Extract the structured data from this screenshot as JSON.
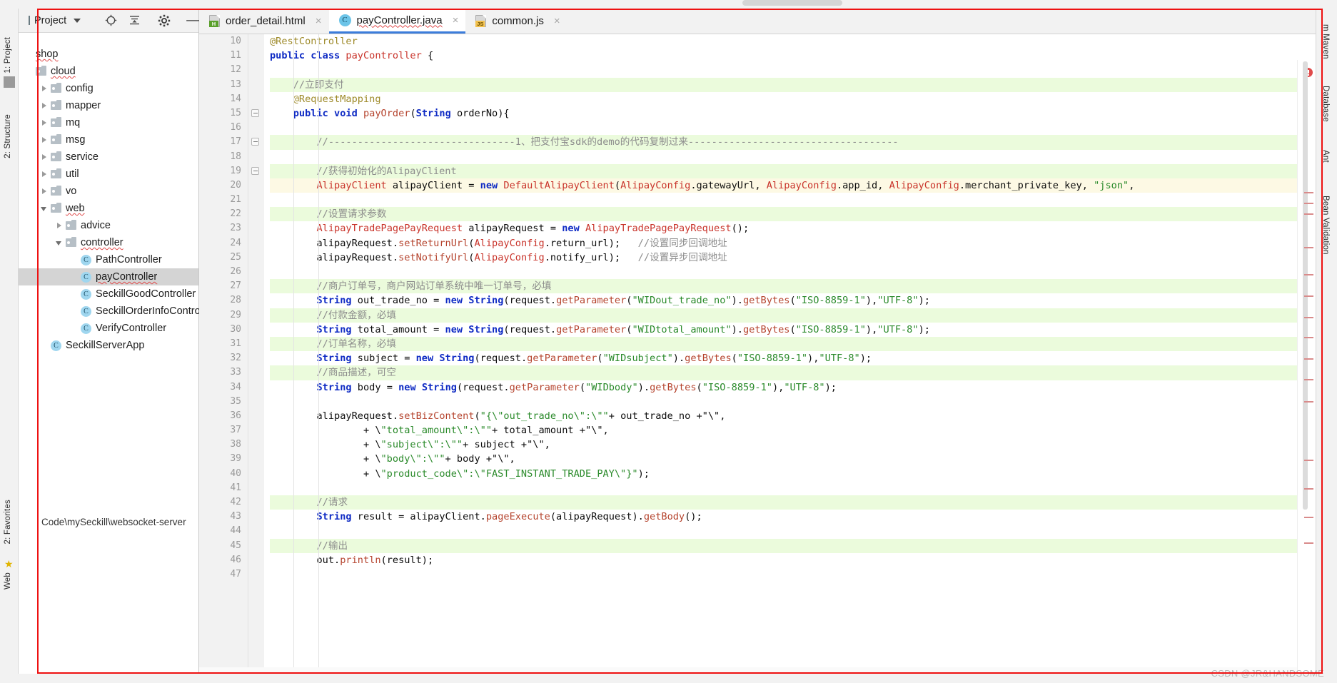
{
  "window": {
    "accent_blue": "#3c7ddb",
    "frame_color": "#ee1111"
  },
  "left_tool_strip": {
    "items": [
      {
        "label": "1: Project",
        "name": "tool-project"
      },
      {
        "label": "2: Structure",
        "name": "tool-structure"
      },
      {
        "label": "2: Favorites",
        "name": "tool-favorites"
      },
      {
        "label": "Web",
        "name": "tool-web"
      }
    ]
  },
  "right_tool_strip": {
    "items": [
      {
        "label": "m Maven",
        "name": "tool-maven"
      },
      {
        "label": "Database",
        "name": "tool-database"
      },
      {
        "label": "Ant",
        "name": "tool-ant"
      },
      {
        "label": "Bean Validation",
        "name": "tool-bean-validation"
      }
    ]
  },
  "project_panel": {
    "title": "Project",
    "icons": [
      "target-icon",
      "collapse-all-icon",
      "gear-icon",
      "minimize-icon"
    ],
    "selected_path": "Code\\mySeckill\\websocket-server",
    "tree": [
      {
        "label": "shop",
        "depth": 0,
        "kind": "root",
        "arrow": "none",
        "selected": false,
        "squiggle": true
      },
      {
        "label": "cloud",
        "depth": 0,
        "kind": "folder",
        "arrow": "none",
        "selected": false,
        "squiggle": true
      },
      {
        "label": "config",
        "depth": 1,
        "kind": "folder",
        "arrow": "right",
        "selected": false,
        "squiggle": false
      },
      {
        "label": "mapper",
        "depth": 1,
        "kind": "folder",
        "arrow": "right",
        "selected": false,
        "squiggle": false
      },
      {
        "label": "mq",
        "depth": 1,
        "kind": "folder",
        "arrow": "right",
        "selected": false,
        "squiggle": false
      },
      {
        "label": "msg",
        "depth": 1,
        "kind": "folder",
        "arrow": "right",
        "selected": false,
        "squiggle": false
      },
      {
        "label": "service",
        "depth": 1,
        "kind": "folder",
        "arrow": "right",
        "selected": false,
        "squiggle": false
      },
      {
        "label": "util",
        "depth": 1,
        "kind": "folder",
        "arrow": "right",
        "selected": false,
        "squiggle": false
      },
      {
        "label": "vo",
        "depth": 1,
        "kind": "folder",
        "arrow": "right",
        "selected": false,
        "squiggle": false
      },
      {
        "label": "web",
        "depth": 1,
        "kind": "folder",
        "arrow": "down",
        "selected": false,
        "squiggle": true
      },
      {
        "label": "advice",
        "depth": 2,
        "kind": "folder",
        "arrow": "right",
        "selected": false,
        "squiggle": false
      },
      {
        "label": "controller",
        "depth": 2,
        "kind": "folder",
        "arrow": "down",
        "selected": false,
        "squiggle": true
      },
      {
        "label": "PathController",
        "depth": 3,
        "kind": "class",
        "arrow": "none",
        "selected": false,
        "squiggle": false
      },
      {
        "label": "payController",
        "depth": 3,
        "kind": "class",
        "arrow": "none",
        "selected": true,
        "squiggle": true
      },
      {
        "label": "SeckillGoodController",
        "depth": 3,
        "kind": "class",
        "arrow": "none",
        "selected": false,
        "squiggle": false
      },
      {
        "label": "SeckillOrderInfoController",
        "depth": 3,
        "kind": "class",
        "arrow": "none",
        "selected": false,
        "squiggle": false
      },
      {
        "label": "VerifyController",
        "depth": 3,
        "kind": "class",
        "arrow": "none",
        "selected": false,
        "squiggle": false
      },
      {
        "label": "SeckillServerApp",
        "depth": 1,
        "kind": "class",
        "arrow": "none",
        "selected": false,
        "squiggle": false
      }
    ]
  },
  "editor": {
    "tabs": [
      {
        "label": "order_detail.html",
        "icon": "html-file-icon",
        "active": false,
        "closable": true
      },
      {
        "label": "payController.java",
        "icon": "java-class-icon",
        "active": true,
        "closable": true
      },
      {
        "label": "common.js",
        "icon": "js-file-icon",
        "active": false,
        "closable": true
      }
    ],
    "first_line_number": 10,
    "lines": [
      {
        "n": 10,
        "hl": "",
        "text": "@RestController"
      },
      {
        "n": 11,
        "hl": "",
        "text": "public class payController {"
      },
      {
        "n": 12,
        "hl": "",
        "text": ""
      },
      {
        "n": 13,
        "hl": "green",
        "text": "    //立即支付"
      },
      {
        "n": 14,
        "hl": "",
        "text": "    @RequestMapping"
      },
      {
        "n": 15,
        "hl": "",
        "text": "    public void payOrder(String orderNo){"
      },
      {
        "n": 16,
        "hl": "",
        "text": ""
      },
      {
        "n": 17,
        "hl": "green",
        "text": "        //--------------------------------1、把支付宝sdk的demo的代码复制过来------------------------------------"
      },
      {
        "n": 18,
        "hl": "",
        "text": ""
      },
      {
        "n": 19,
        "hl": "green",
        "text": "        //获得初始化的AlipayClient"
      },
      {
        "n": 20,
        "hl": "cream",
        "text": "        AlipayClient alipayClient = new DefaultAlipayClient(AlipayConfig.gatewayUrl, AlipayConfig.app_id, AlipayConfig.merchant_private_key, \"json\","
      },
      {
        "n": 21,
        "hl": "",
        "text": ""
      },
      {
        "n": 22,
        "hl": "green",
        "text": "        //设置请求参数"
      },
      {
        "n": 23,
        "hl": "",
        "text": "        AlipayTradePagePayRequest alipayRequest = new AlipayTradePagePayRequest();"
      },
      {
        "n": 24,
        "hl": "",
        "text": "        alipayRequest.setReturnUrl(AlipayConfig.return_url);   //设置同步回调地址"
      },
      {
        "n": 25,
        "hl": "",
        "text": "        alipayRequest.setNotifyUrl(AlipayConfig.notify_url);   //设置异步回调地址"
      },
      {
        "n": 26,
        "hl": "",
        "text": ""
      },
      {
        "n": 27,
        "hl": "green",
        "text": "        //商户订单号，商户网站订单系统中唯一订单号，必填"
      },
      {
        "n": 28,
        "hl": "",
        "text": "        String out_trade_no = new String(request.getParameter(\"WIDout_trade_no\").getBytes(\"ISO-8859-1\"),\"UTF-8\");"
      },
      {
        "n": 29,
        "hl": "green",
        "text": "        //付款金额，必填"
      },
      {
        "n": 30,
        "hl": "",
        "text": "        String total_amount = new String(request.getParameter(\"WIDtotal_amount\").getBytes(\"ISO-8859-1\"),\"UTF-8\");"
      },
      {
        "n": 31,
        "hl": "green",
        "text": "        //订单名称，必填"
      },
      {
        "n": 32,
        "hl": "",
        "text": "        String subject = new String(request.getParameter(\"WIDsubject\").getBytes(\"ISO-8859-1\"),\"UTF-8\");"
      },
      {
        "n": 33,
        "hl": "green",
        "text": "        //商品描述，可空"
      },
      {
        "n": 34,
        "hl": "",
        "text": "        String body = new String(request.getParameter(\"WIDbody\").getBytes(\"ISO-8859-1\"),\"UTF-8\");"
      },
      {
        "n": 35,
        "hl": "",
        "text": ""
      },
      {
        "n": 36,
        "hl": "",
        "text": "        alipayRequest.setBizContent(\"{\\\"out_trade_no\\\":\\\"\"+ out_trade_no +\"\\\","
      },
      {
        "n": 37,
        "hl": "",
        "text": "                + \\\"total_amount\\\":\\\"\"+ total_amount +\"\\\","
      },
      {
        "n": 38,
        "hl": "",
        "text": "                + \\\"subject\\\":\\\"\"+ subject +\"\\\","
      },
      {
        "n": 39,
        "hl": "",
        "text": "                + \\\"body\\\":\\\"\"+ body +\"\\\","
      },
      {
        "n": 40,
        "hl": "",
        "text": "                + \\\"product_code\\\":\\\"FAST_INSTANT_TRADE_PAY\\\"}\");"
      },
      {
        "n": 41,
        "hl": "",
        "text": ""
      },
      {
        "n": 42,
        "hl": "green",
        "text": "        //请求"
      },
      {
        "n": 43,
        "hl": "",
        "text": "        String result = alipayClient.pageExecute(alipayRequest).getBody();"
      },
      {
        "n": 44,
        "hl": "",
        "text": ""
      },
      {
        "n": 45,
        "hl": "green",
        "text": "        //输出"
      },
      {
        "n": 46,
        "hl": "",
        "text": "        out.println(result);"
      },
      {
        "n": 47,
        "hl": "",
        "text": ""
      }
    ]
  },
  "status": {
    "watermark": "CSDN @JR&HANDSOME"
  }
}
